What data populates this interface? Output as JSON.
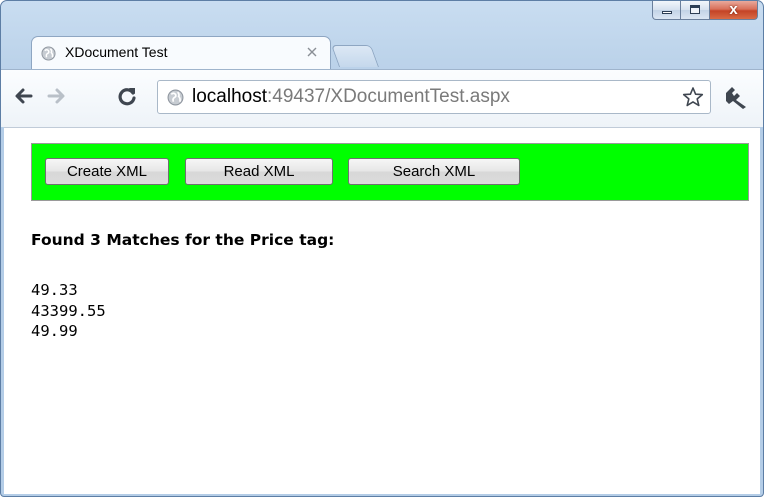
{
  "window": {
    "controls": {
      "minimize_icon": "minimize-icon",
      "maximize_icon": "maximize-icon",
      "close_glyph": "x"
    }
  },
  "tab": {
    "title": "XDocument Test",
    "favicon": "globe-icon",
    "close_icon": "close-icon"
  },
  "toolbar": {
    "back_icon": "back-arrow-icon",
    "forward_icon": "forward-arrow-icon",
    "reload_icon": "reload-icon",
    "url_host": "localhost",
    "url_rest": ":49437/XDocumentTest.aspx",
    "bookmark_icon": "star-icon",
    "menu_icon": "wrench-icon"
  },
  "page": {
    "panel_color": "#00ff00",
    "buttons": {
      "create": "Create XML",
      "read": "Read XML",
      "search": "Search XML"
    },
    "heading": "Found 3 Matches for the Price tag:",
    "results": [
      "49.33",
      "43399.55",
      "49.99"
    ]
  }
}
